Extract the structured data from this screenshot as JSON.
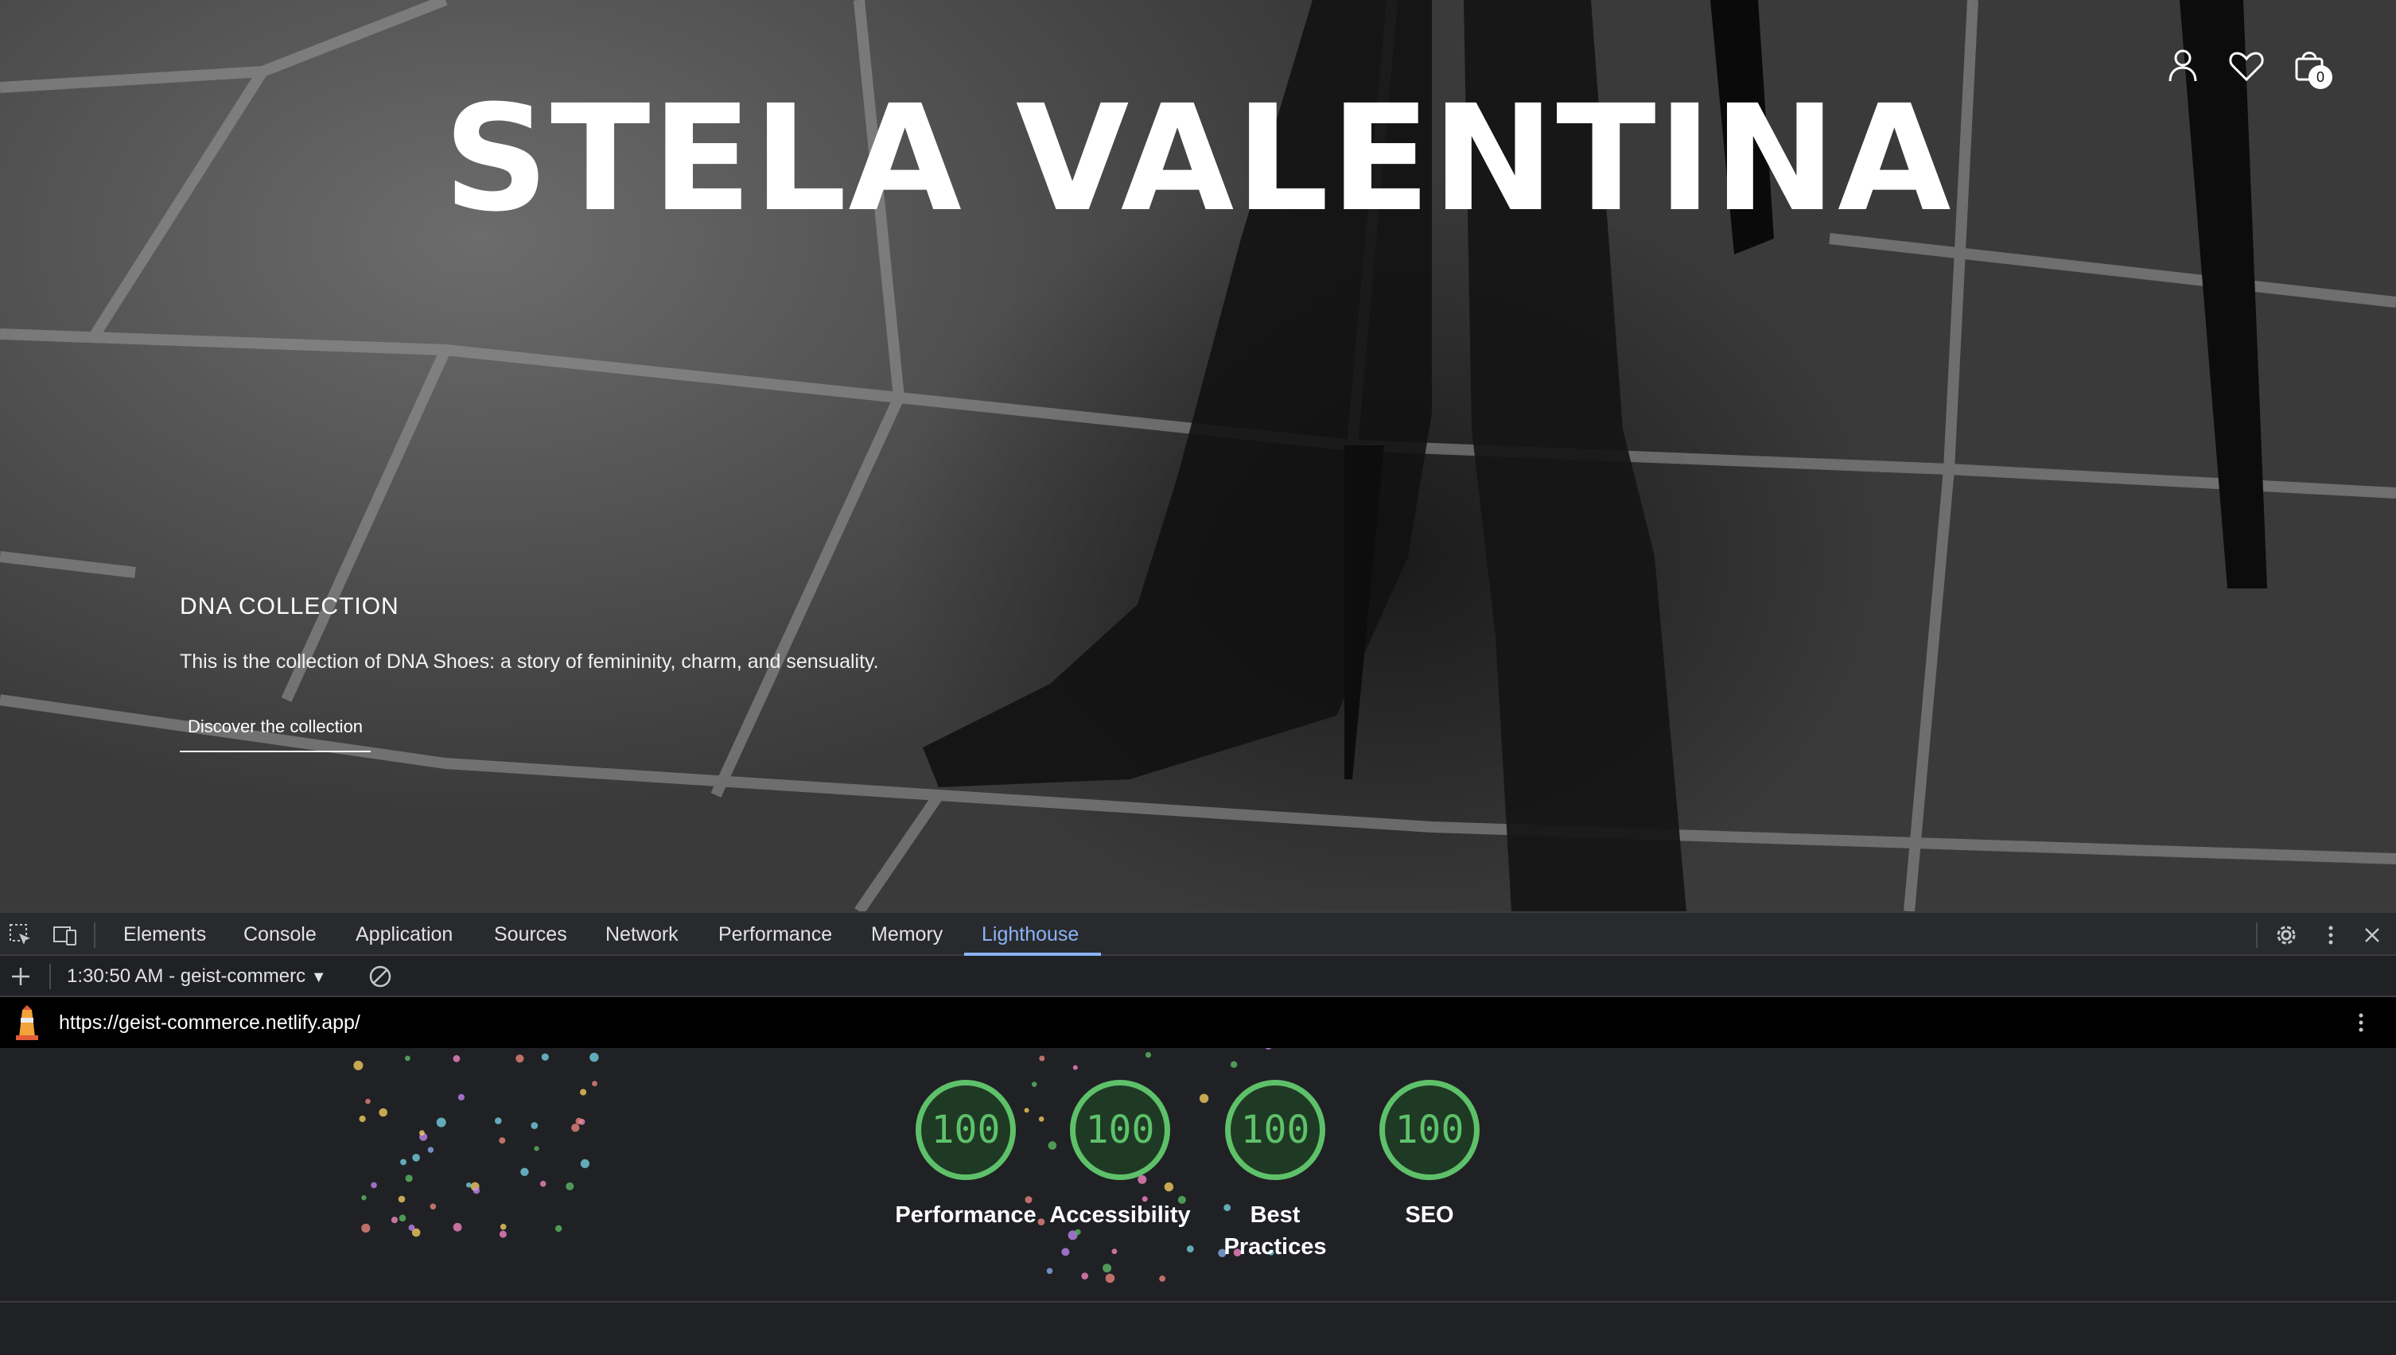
{
  "hero": {
    "brand": "STELA VALENTINA",
    "cart_count": "0",
    "collection_title": "DNA COLLECTION",
    "collection_description": "This is the collection of DNA Shoes: a story of femininity, charm, and sensuality.",
    "collection_link": "Discover the collection",
    "header_icons": [
      "account-icon",
      "wishlist-heart-icon",
      "cart-bag-icon"
    ]
  },
  "devtools": {
    "tabs": [
      "Elements",
      "Console",
      "Application",
      "Sources",
      "Network",
      "Performance",
      "Memory",
      "Lighthouse"
    ],
    "active_tab": "Lighthouse",
    "report_select": "1:30:50 AM - geist-commerc",
    "url": "https://geist-commerce.netlify.app/",
    "scores": [
      {
        "value": "100",
        "label": "Performance"
      },
      {
        "value": "100",
        "label": "Accessibility"
      },
      {
        "value": "100",
        "label": "Best Practices"
      },
      {
        "value": "100",
        "label": "SEO"
      }
    ],
    "colors": {
      "pass": "#5ec16a",
      "active_tab": "#8ab4f8",
      "panel_bg": "#202124"
    }
  }
}
